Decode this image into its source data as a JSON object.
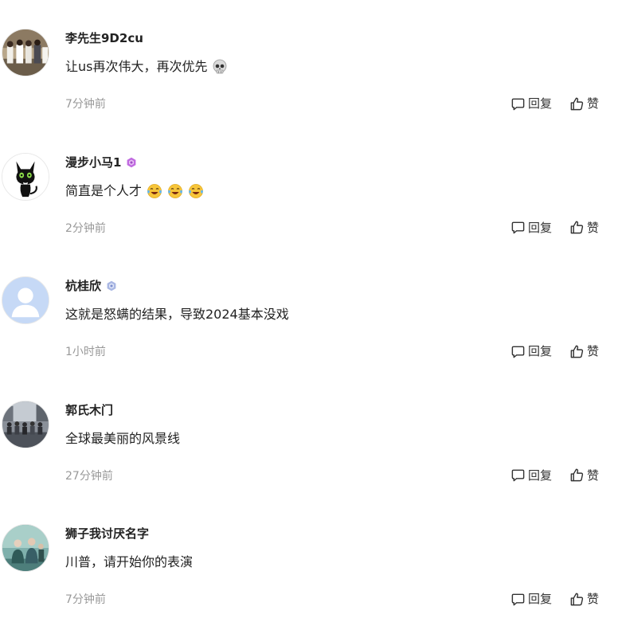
{
  "comments": [
    {
      "username": "李先生9D2cu",
      "badge": "none",
      "content": "让us再次伟大，再次优先",
      "emoji": [
        "skull-emoji"
      ],
      "time": "7分钟前",
      "reply_label": "回复",
      "like_label": "赞"
    },
    {
      "username": "漫步小马1",
      "badge": "purple-level-badge",
      "content": "简直是个人才",
      "emoji": [
        "laughing-tears-emoji",
        "laughing-tears-emoji",
        "laughing-tears-emoji"
      ],
      "time": "2分钟前",
      "reply_label": "回复",
      "like_label": "赞"
    },
    {
      "username": "杭桂欣",
      "badge": "blue-level-badge",
      "content": "这就是怒螨的结果，导致2024基本没戏",
      "emoji": [],
      "time": "1小时前",
      "reply_label": "回复",
      "like_label": "赞"
    },
    {
      "username": "郭氏木门",
      "badge": "none",
      "content": "全球最美丽的风景线",
      "emoji": [],
      "time": "27分钟前",
      "reply_label": "回复",
      "like_label": "赞"
    },
    {
      "username": "狮子我讨厌名字",
      "badge": "none",
      "content": "川普，请开始你的表演",
      "emoji": [],
      "time": "7分钟前",
      "reply_label": "回复",
      "like_label": "赞"
    }
  ],
  "colors": {
    "text": "#222222",
    "muted": "#999999",
    "action": "#333333",
    "badge_purple": "#c06ae0",
    "badge_blue": "#8a9bd6"
  }
}
